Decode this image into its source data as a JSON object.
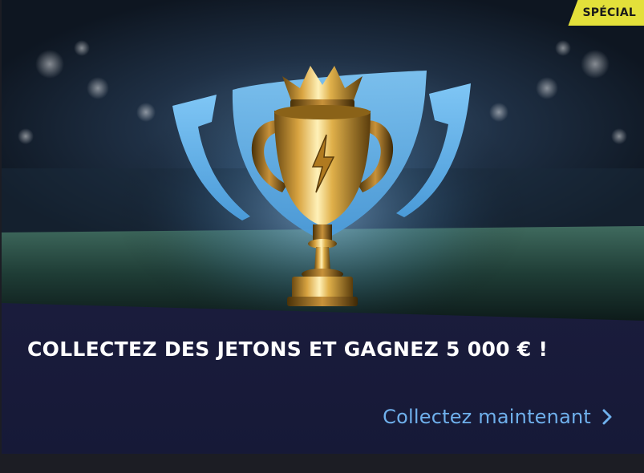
{
  "promo": {
    "badge": "SPÉCIAL",
    "headline": "COLLECTEZ DES JETONS ET GAGNEZ 5 000 € !",
    "cta_label": "Collectez maintenant",
    "image_icon": "trophy-icon",
    "cta_icon": "chevron-right-icon"
  },
  "colors": {
    "badge_bg": "#e3e03a",
    "card_bg": "#161937",
    "cta_text": "#6fb0ec",
    "headline_text": "#ffffff",
    "shield_blue": "#5fb4ec"
  }
}
